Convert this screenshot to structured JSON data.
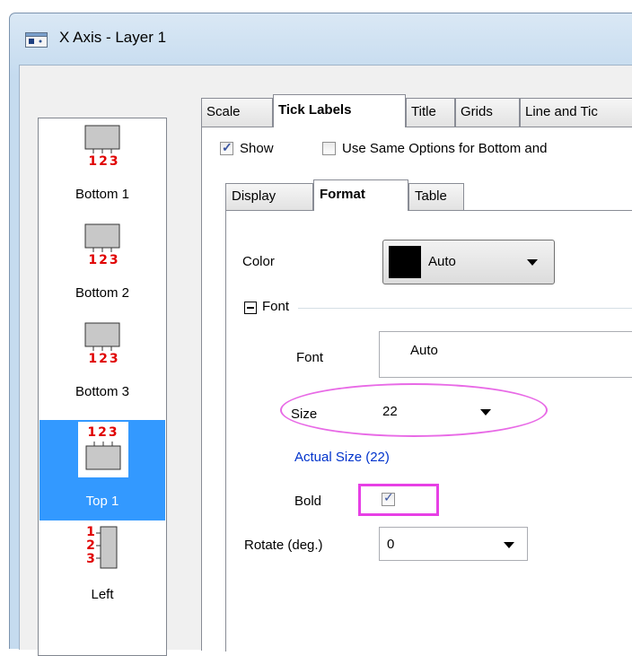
{
  "window": {
    "title": "X Axis - Layer 1",
    "icon": "window-app-icon"
  },
  "axis_list": [
    {
      "label": "Bottom 1",
      "numbers": "123",
      "selected": false
    },
    {
      "label": "Bottom 2",
      "numbers": "123",
      "selected": false
    },
    {
      "label": "Bottom 3",
      "numbers": "123",
      "selected": false
    },
    {
      "label": "Top 1",
      "numbers": "123",
      "selected": true
    },
    {
      "label": "Left",
      "numbers": "123",
      "selected": false
    }
  ],
  "tabs": [
    "Scale",
    "Tick Labels",
    "Title",
    "Grids",
    "Line and Tic"
  ],
  "active_tab": "Tick Labels",
  "options": {
    "show_label": "Show",
    "show_checked": true,
    "same_options_label": "Use Same Options for Bottom and",
    "same_options_checked": false
  },
  "subtabs": [
    "Display",
    "Format",
    "Table"
  ],
  "active_subtab": "Format",
  "format": {
    "color_label": "Color",
    "color_value": "Auto",
    "color_swatch": "#000000",
    "font_group_label": "Font",
    "font_label": "Font",
    "font_value": "Auto",
    "size_label": "Size",
    "size_value": "22",
    "actual_size": "Actual Size (22)",
    "bold_label": "Bold",
    "bold_checked": true,
    "rotate_label": "Rotate (deg.)",
    "rotate_value": "0"
  },
  "colors": {
    "selection": "#3399ff",
    "highlight": "#e740e5",
    "link": "#0033cc",
    "tick_numbers": "#e00000"
  }
}
